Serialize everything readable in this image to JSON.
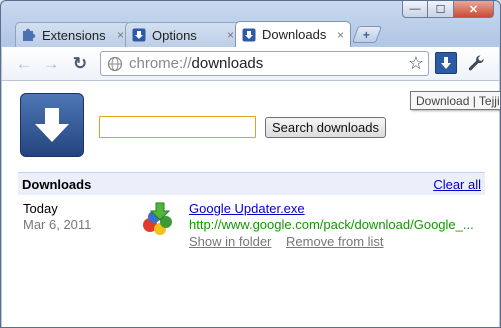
{
  "tabs": [
    {
      "label": "Extensions",
      "close": "×",
      "icon": "puzzle-icon",
      "active": false
    },
    {
      "label": "Options",
      "close": "×",
      "icon": "download-icon",
      "active": false
    },
    {
      "label": "Downloads",
      "close": "×",
      "icon": "download-icon",
      "active": true
    }
  ],
  "new_tab_label": "+",
  "window_controls": {
    "minimize": "—",
    "maximize": "☐",
    "close": "✕"
  },
  "toolbar": {
    "back": "←",
    "forward": "→",
    "reload": "↻",
    "url_scheme": "chrome://",
    "url_host": "downloads",
    "star": "☆"
  },
  "tooltip": "Download | Tejji",
  "search": {
    "value": "",
    "placeholder": "",
    "button_label": "Search downloads"
  },
  "downloads": {
    "header": "Downloads",
    "clear_all": "Clear all",
    "items": [
      {
        "date_label": "Today",
        "date": "Mar 6, 2011",
        "file_name": "Google Updater.exe",
        "url": "http://www.google.com/pack/download/Google_...",
        "show_in_folder": "Show in folder",
        "remove": "Remove from list"
      }
    ]
  },
  "colors": {
    "accent": "#2d5aa4",
    "link": "#0000cc",
    "url_green": "#109900",
    "search_border": "#e3a021"
  }
}
